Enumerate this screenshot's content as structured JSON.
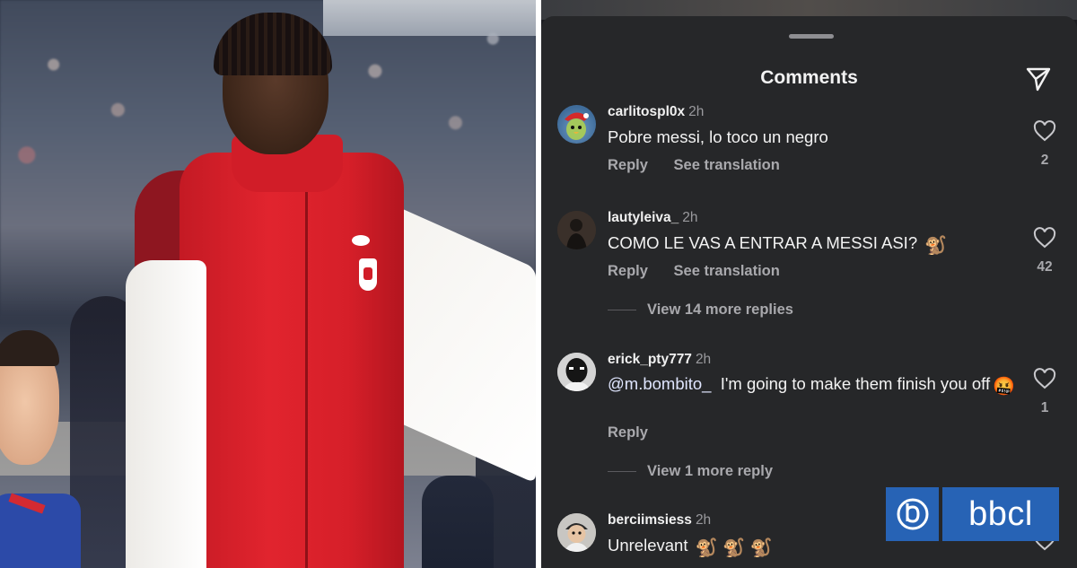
{
  "photo": {
    "alt_subject": "player-photo"
  },
  "comments_sheet": {
    "title": "Comments",
    "share_icon": "send-icon",
    "comments": [
      {
        "username": "carlitospl0x",
        "time": "2h",
        "text": "Pobre messi, lo toco un negro",
        "emoji": "",
        "actions": [
          "Reply",
          "See translation"
        ],
        "likes": "2",
        "more_replies": ""
      },
      {
        "username": "lautyleiva_",
        "time": "2h",
        "text": "COMO LE VAS A ENTRAR A MESSI ASI?",
        "emoji": "🐒",
        "actions": [
          "Reply",
          "See translation"
        ],
        "likes": "42",
        "more_replies": "View 14 more replies"
      },
      {
        "username": "erick_pty777",
        "time": "2h",
        "mention": "@m.bombito_",
        "text": "I'm going to make them finish you off",
        "emoji": "🤬",
        "actions": [
          "Reply"
        ],
        "likes": "1",
        "more_replies": "View 1 more reply"
      },
      {
        "username": "berciimsiess",
        "time": "2h",
        "text": "Unrelevant",
        "emoji": "🐒 🐒 🐒",
        "actions": [],
        "likes": "",
        "more_replies": ""
      }
    ]
  },
  "badge": {
    "text": "bbcl",
    "color": "#2763b5"
  }
}
